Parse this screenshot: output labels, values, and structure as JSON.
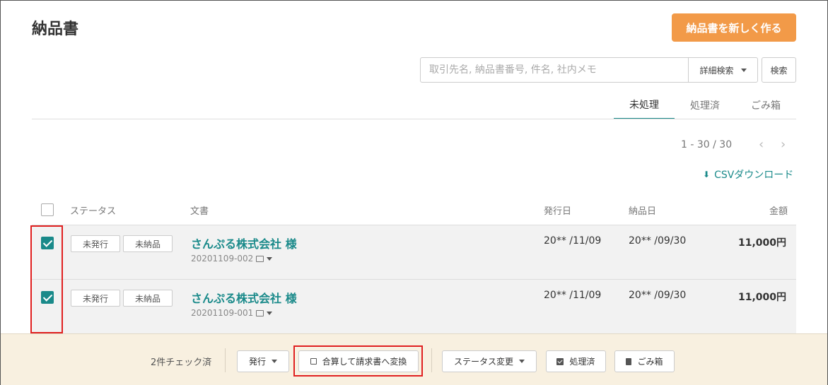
{
  "page": {
    "title": "納品書",
    "new_button": "納品書を新しく作る"
  },
  "search": {
    "placeholder": "取引先名, 納品書番号, 件名, 社内メモ",
    "advanced_label": "詳細検索",
    "search_button": "検索"
  },
  "tabs": [
    {
      "label": "未処理",
      "active": true
    },
    {
      "label": "処理済",
      "active": false
    },
    {
      "label": "ごみ箱",
      "active": false
    }
  ],
  "pagination": {
    "range": "1 - 30 / 30",
    "prev": "‹",
    "next": "›"
  },
  "csv_download": "CSVダウンロード",
  "table": {
    "headers": {
      "status": "ステータス",
      "document": "文書",
      "issue_date": "発行日",
      "delivery_date": "納品日",
      "amount": "金額"
    },
    "rows": [
      {
        "checked": true,
        "badges": [
          "未発行",
          "未納品"
        ],
        "company": "さんぷる株式会社 様",
        "doc_no": "20201109-002",
        "issue_date": "20** /11/09",
        "delivery_date": "20** /09/30",
        "amount": "11,000円"
      },
      {
        "checked": true,
        "badges": [
          "未発行",
          "未納品"
        ],
        "company": "さんぷる株式会社 様",
        "doc_no": "20201109-001",
        "issue_date": "20** /11/09",
        "delivery_date": "20** /09/30",
        "amount": "11,000円"
      }
    ]
  },
  "bulk_bar": {
    "count_label": "2件チェック済",
    "issue_button": "発行",
    "merge_button": "合算して請求書へ変換",
    "status_change_button": "ステータス変更",
    "processed_button": "処理済",
    "trash_button": "ごみ箱"
  },
  "colors": {
    "accent": "#1a8a8a",
    "primary_button": "#f29a48",
    "highlight": "#e02020",
    "bulk_bar_bg": "#f8f0e0"
  }
}
